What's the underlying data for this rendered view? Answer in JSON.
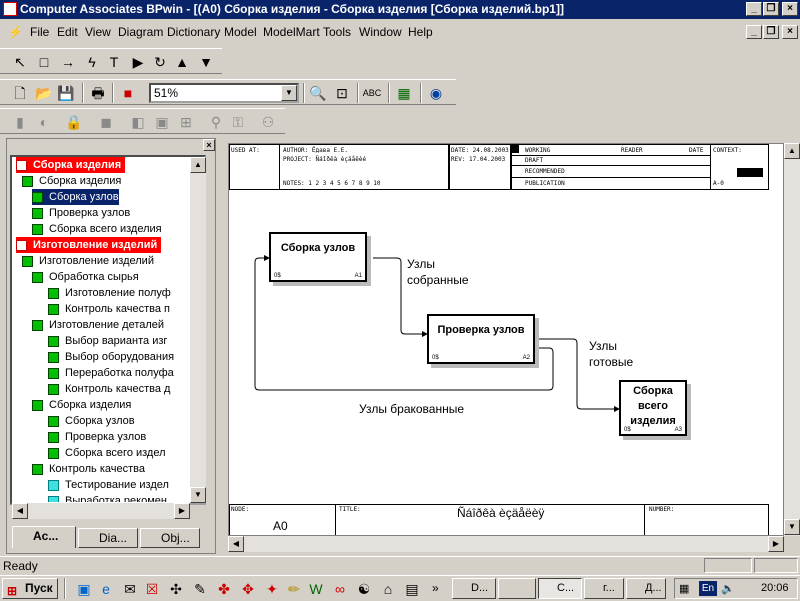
{
  "window": {
    "title": "Computer Associates BPwin - [(A0) Сборка изделия - Сборка изделия  [Сборка изделий.bp1]]",
    "min": "_",
    "max": "❐",
    "close": "×"
  },
  "menu": [
    "File",
    "Edit",
    "View",
    "Diagram",
    "Dictionary",
    "Model",
    "ModelMart",
    "Tools",
    "Window",
    "Help"
  ],
  "toolbar": {
    "zoom": "51%"
  },
  "tree": {
    "items": [
      {
        "label": "Сборка изделия",
        "type": "hdr"
      },
      {
        "label": "Сборка изделия",
        "type": "n"
      },
      {
        "label": "Сборка узлов",
        "type": "sel"
      },
      {
        "label": "Проверка узлов",
        "type": "n"
      },
      {
        "label": "Сборка всего изделия",
        "type": "n"
      },
      {
        "label": "Изготовление изделий",
        "type": "hdr"
      },
      {
        "label": "Изготовление изделий",
        "type": "n"
      },
      {
        "label": "Обработка  сырья",
        "type": "n"
      },
      {
        "label": "Изготовление полуф",
        "type": "n"
      },
      {
        "label": "Контроль качества п",
        "type": "n"
      },
      {
        "label": "Изготовление  деталей",
        "type": "n"
      },
      {
        "label": "Выбор  варианта изг",
        "type": "n"
      },
      {
        "label": "Выбор оборудования",
        "type": "n"
      },
      {
        "label": "Переработка полуфа",
        "type": "n"
      },
      {
        "label": "Контроль качества д",
        "type": "n"
      },
      {
        "label": "Сборка изделия",
        "type": "n"
      },
      {
        "label": "Сборка узлов",
        "type": "n"
      },
      {
        "label": "Проверка узлов",
        "type": "n"
      },
      {
        "label": "Сборка всего издел",
        "type": "n"
      },
      {
        "label": "Контроль качества",
        "type": "n"
      },
      {
        "label": "Тестирование издел",
        "type": "c"
      },
      {
        "label": "Выработка рекомен",
        "type": "c"
      }
    ],
    "tabs": [
      "Ac...",
      "Dia...",
      "Obj..."
    ]
  },
  "diagram": {
    "header": {
      "used_at": "USED AT:",
      "author": "AUTHOR:  Ёдава Е.Е.",
      "project": "PROJECT:  Ñáîðêà èçäåëèé",
      "notes": "NOTES:  1  2  3  4  5  6  7  8  9  10",
      "date": "DATE: 24.08.2003",
      "rev": "REV:   17.04.2003",
      "working": "WORKING",
      "draft": "DRAFT",
      "recommended": "RECOMMENDED",
      "publication": "PUBLICATION",
      "reader": "READER",
      "date2": "DATE",
      "context": "CONTEXT:",
      "a0": "A-0"
    },
    "boxes": [
      {
        "title": "Сборка узлов",
        "cost": "0$",
        "num": "A1"
      },
      {
        "title": "Проверка узлов",
        "cost": "0$",
        "num": "A2"
      },
      {
        "title": "Сборка всего изделия",
        "cost": "0$",
        "num": "A3"
      }
    ],
    "arrows": {
      "a1": "Узлы собранные",
      "a2": "Узлы готовые",
      "a3": "Узлы бракованные"
    },
    "footer": {
      "node_lbl": "NODE:",
      "node": "A0",
      "title_lbl": "TITLE:",
      "title": "Ñáîðêà èçäåëèÿ",
      "number_lbl": "NUMBER:"
    }
  },
  "status": "Ready",
  "taskbar": {
    "start": "Пуск",
    "items": [
      "D...",
      "",
      "С...",
      "г...",
      "Д..."
    ],
    "lang": "En",
    "clock": "20:06"
  }
}
